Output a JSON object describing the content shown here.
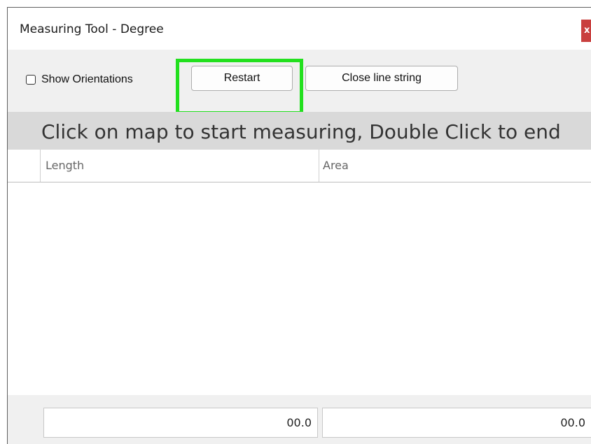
{
  "window": {
    "title": "Measuring Tool - Degree",
    "close_glyph": "x"
  },
  "toolbar": {
    "show_orientations_label": "Show Orientations",
    "show_orientations_checked": false,
    "restart_label": "Restart",
    "close_line_string_label": "Close line string",
    "highlight_color": "#22e01e"
  },
  "banner": {
    "instruction": "Click on map to start measuring, Double Click to end"
  },
  "table": {
    "columns": [
      "Length",
      "Area"
    ],
    "rows": []
  },
  "totals": {
    "length": "00.0",
    "area": "00.0"
  }
}
